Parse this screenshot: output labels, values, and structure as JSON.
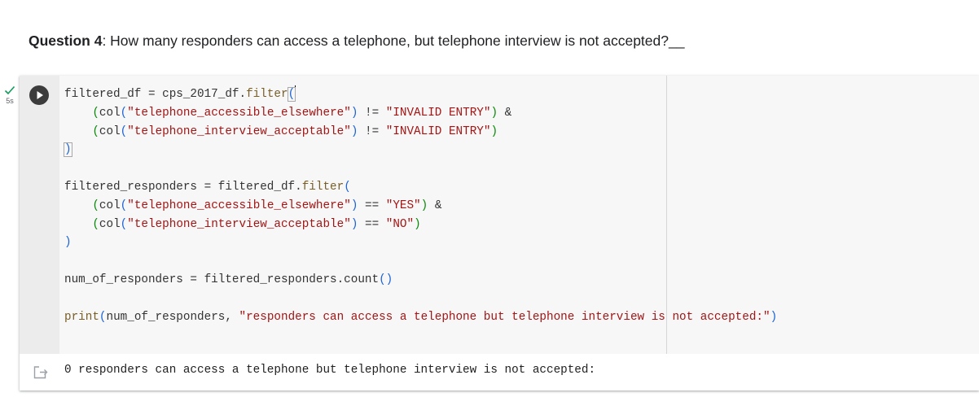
{
  "question": {
    "number_label": "Question 4",
    "text": ": How many responders can access a telephone, but telephone interview is not accepted?__"
  },
  "cell_status": {
    "icon": "check-icon",
    "duration": "5s"
  },
  "code_lines": {
    "l1_a": "filtered_df = cps_2017_df.",
    "l1_fn": "filter",
    "l1_open": "(",
    "l2_indent": "    ",
    "l2_open": "(",
    "l2_col": "col",
    "l2_p1": "(",
    "l2_str": "\"telephone_accessible_elsewhere\"",
    "l2_p2": ")",
    "l2_op": " != ",
    "l2_str2": "\"INVALID ENTRY\"",
    "l2_close": ")",
    "l2_end": " &",
    "l3_indent": "    ",
    "l3_open": "(",
    "l3_col": "col",
    "l3_p1": "(",
    "l3_str": "\"telephone_interview_acceptable\"",
    "l3_p2": ")",
    "l3_op": " != ",
    "l3_str2": "\"INVALID ENTRY\"",
    "l3_close": ")",
    "l4_close": ")",
    "l6_a": "filtered_responders = filtered_df.",
    "l6_fn": "filter",
    "l6_open": "(",
    "l7_indent": "    ",
    "l7_open": "(",
    "l7_col": "col",
    "l7_p1": "(",
    "l7_str": "\"telephone_accessible_elsewhere\"",
    "l7_p2": ")",
    "l7_op": " == ",
    "l7_str2": "\"YES\"",
    "l7_close": ")",
    "l7_end": " &",
    "l8_indent": "    ",
    "l8_open": "(",
    "l8_col": "col",
    "l8_p1": "(",
    "l8_str": "\"telephone_interview_acceptable\"",
    "l8_p2": ")",
    "l8_op": " == ",
    "l8_str2": "\"NO\"",
    "l8_close": ")",
    "l9_close": ")",
    "l11_a": "num_of_responders = filtered_responders.count",
    "l11_parens": "()",
    "l13_fn": "print",
    "l13_open": "(",
    "l13_mid": "num_of_responders, ",
    "l13_str": "\"responders can access a telephone but telephone interview is not accepted:\"",
    "l13_close": ")"
  },
  "output": {
    "icon": "output-redirect-icon",
    "text": "0 responders can access a telephone but telephone interview is not accepted:"
  },
  "colors": {
    "string": "#a31515",
    "paren": "#1e63d6",
    "inner_paren": "#0a8a0a",
    "function": "#795e26",
    "run_button": "#3c3c3c",
    "status_check": "#0f9d58"
  }
}
